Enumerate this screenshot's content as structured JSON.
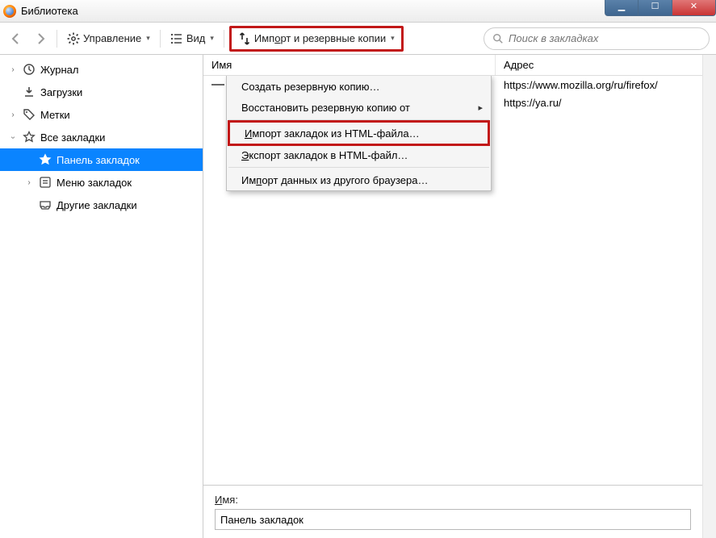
{
  "window": {
    "title": "Библиотека"
  },
  "toolbar": {
    "manage": "Управление",
    "view": "Вид",
    "import": "Импорт и резервные копии",
    "import_underline": "о"
  },
  "search": {
    "placeholder": "Поиск в закладках"
  },
  "sidebar": {
    "history": "Журнал",
    "downloads": "Загрузки",
    "tags": "Метки",
    "all": "Все закладки",
    "panel": "Панель закладок",
    "menu": "Меню закладок",
    "other": "Другие закладки"
  },
  "columns": {
    "name": "Имя",
    "address": "Адрес"
  },
  "rows": [
    {
      "type": "sep",
      "addr": "https://www.mozilla.org/ru/firefox/"
    },
    {
      "type": "link",
      "addr": "https://ya.ru/"
    }
  ],
  "menu": {
    "backup": "Создать резервную копию…",
    "restore": "Восстановить резервную копию от",
    "import_html": "Импорт закладок из HTML-файла…",
    "export_html": "Экспорт закладок в HTML-файл…",
    "import_browser": "Импорт данных из другого браузера…"
  },
  "details": {
    "name_label": "Имя:",
    "name_label_u": "И",
    "value": "Панель закладок"
  }
}
